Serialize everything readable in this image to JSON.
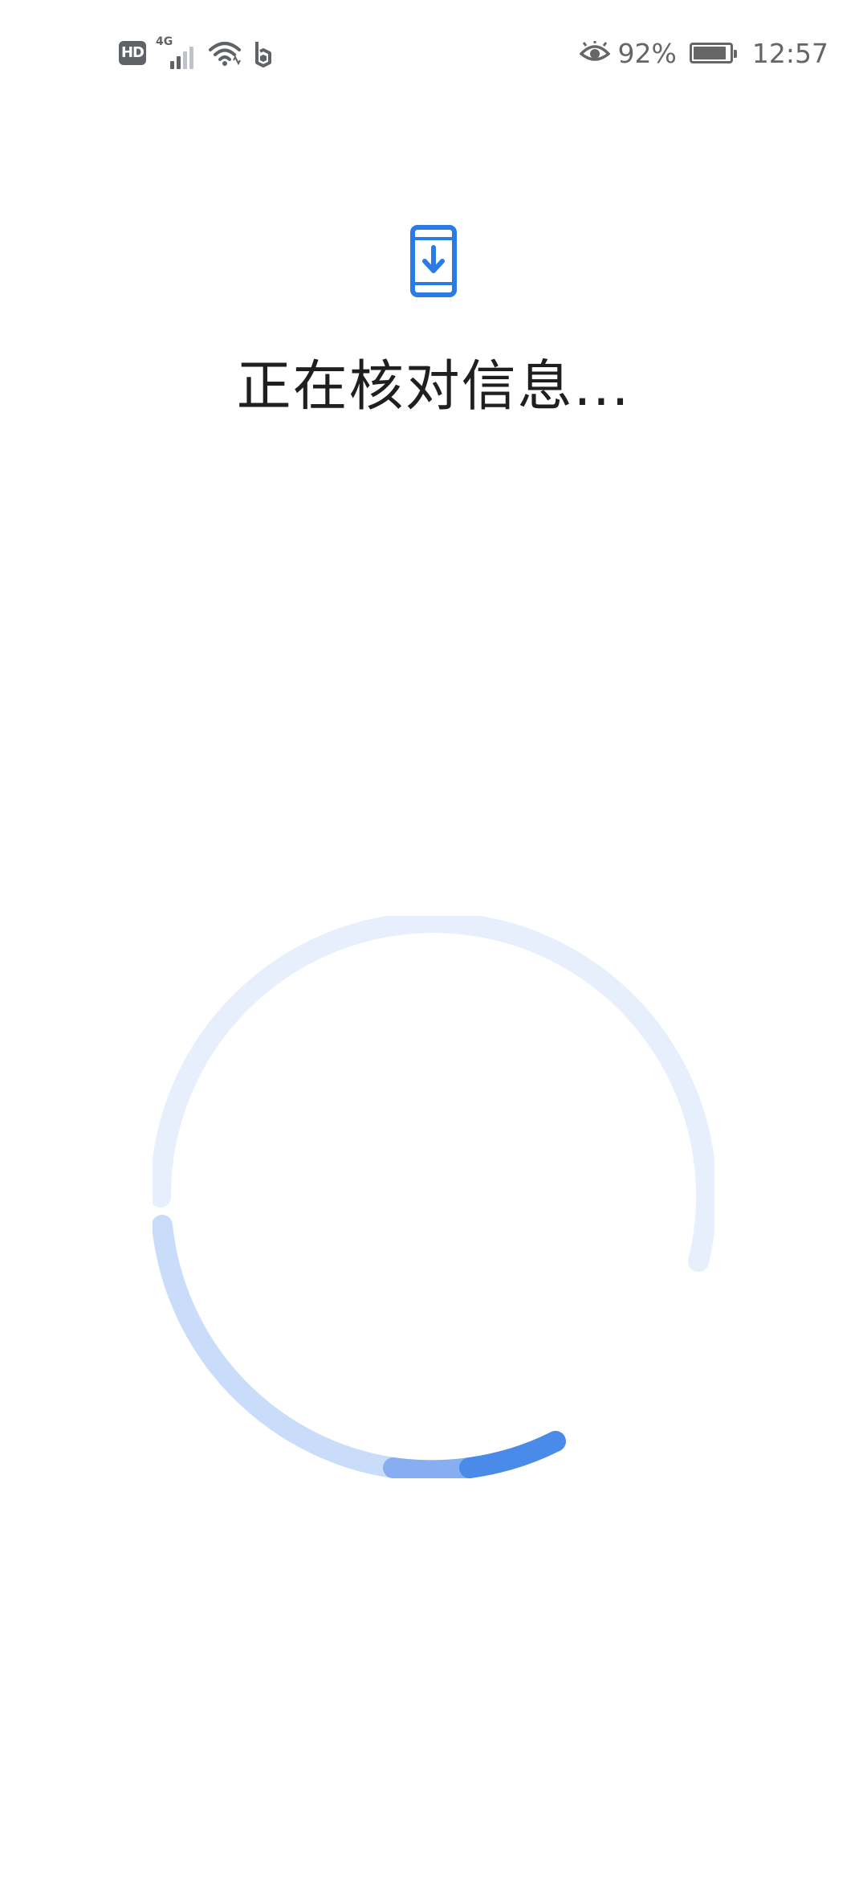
{
  "status_bar": {
    "hd_label": "HD",
    "network_type": "4G",
    "signal_strength_bars": 2,
    "wifi_icon": "wifi-icon",
    "app_notification_icon": "b-logo-icon",
    "eye_comfort_icon": "eye-icon",
    "battery_percent_text": "92%",
    "battery_level": 0.92,
    "time": "12:57"
  },
  "header": {
    "icon": "phone-download-icon",
    "title": "正在核对信息..."
  },
  "colors": {
    "accent": "#2B7BE4",
    "spinner_track": "#E8EFFC",
    "spinner_light": "#C9DCF9",
    "spinner_mid": "#86AEF0",
    "spinner_active": "#4A8BEA"
  }
}
